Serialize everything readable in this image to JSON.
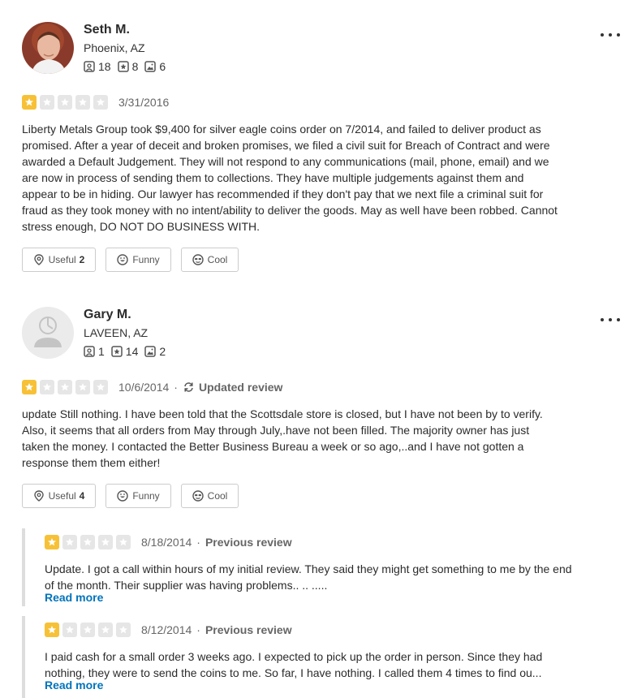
{
  "reviews": [
    {
      "name": "Seth M.",
      "location": "Phoenix, AZ",
      "stats": {
        "friends": "18",
        "reviews": "8",
        "photos": "6"
      },
      "rating": 1,
      "date": "3/31/2016",
      "text": "Liberty Metals Group took $9,400 for silver eagle coins order on 7/2014, and failed to deliver product as promised. After a year of deceit and broken promises, we filed a civil suit for Breach of Contract and were awarded a Default Judgement. They will not respond to any communications (mail, phone, email) and we are now in process of sending them to collections. They have multiple judgements against them and appear to be in hiding. Our lawyer has recommended if they don't pay that we next file a criminal suit for fraud as they took money with no intent/ability to deliver the goods. May as well have been robbed. Cannot stress enough, DO NOT DO BUSINESS WITH.",
      "useful_label": "Useful",
      "useful_count": "2",
      "funny_label": "Funny",
      "cool_label": "Cool"
    },
    {
      "name": "Gary M.",
      "location": "LAVEEN, AZ",
      "stats": {
        "friends": "1",
        "reviews": "14",
        "photos": "2"
      },
      "rating": 1,
      "date": "10/6/2014",
      "separator": "·",
      "updated_label": "Updated review",
      "text": "update   Still nothing.  I have been told that the Scottsdale store is closed, but I have not been by to verify.  Also, it seems that all orders from May through July,.have not been filled.  The majority owner has just taken the money.  I contacted the Better Business Bureau a week or so ago,..and I have not gotten a response them them either!",
      "useful_label": "Useful",
      "useful_count": "4",
      "funny_label": "Funny",
      "cool_label": "Cool",
      "previous": [
        {
          "rating": 1,
          "date": "8/18/2014",
          "separator": "·",
          "label": "Previous review",
          "text": "Update.   I got a call within hours of my initial review.  They said they might get something to me by the end of the month.  Their supplier was having problems..  .. .....",
          "read_more": "Read more"
        },
        {
          "rating": 1,
          "date": "8/12/2014",
          "separator": "·",
          "label": "Previous review",
          "text": "I paid cash for a small order 3 weeks ago.  I expected to pick up the order in person.  Since they had nothing, they were to send the coins to me.  So far, I have nothing.  I called them 4 times to find ou...",
          "read_more": "Read more"
        }
      ]
    }
  ],
  "colors": {
    "star_on": "#f7c137",
    "star_off": "#e6e6e6",
    "link": "#0073bb"
  }
}
